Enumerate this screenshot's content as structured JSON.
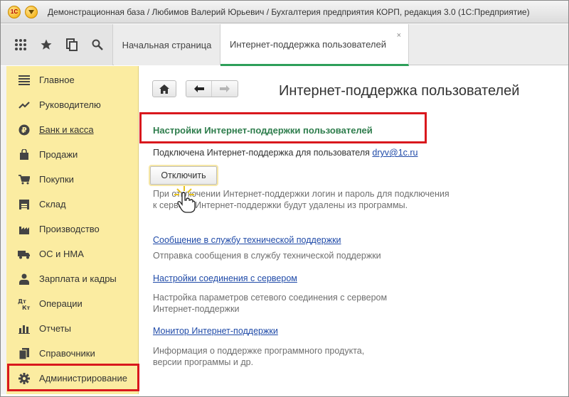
{
  "window": {
    "title": "Демонстрационная база / Любимов Валерий Юрьевич / Бухгалтерия предприятия КОРП, редакция 3.0  (1С:Предприятие)",
    "logo_text": "1С"
  },
  "toolbar": {
    "icons": [
      "apps-grid-icon",
      "star-icon",
      "history-icon",
      "search-icon"
    ]
  },
  "tabs": [
    {
      "label": "Начальная страница",
      "active": false
    },
    {
      "label": "Интернет-поддержка пользователей",
      "active": true,
      "close": "×"
    }
  ],
  "sidebar": {
    "items": [
      {
        "label": "Главное",
        "icon": "menu-lines-icon"
      },
      {
        "label": "Руководителю",
        "icon": "trend-icon"
      },
      {
        "label": "Банк и касса",
        "icon": "ruble-icon"
      },
      {
        "label": "Продажи",
        "icon": "bag-icon"
      },
      {
        "label": "Покупки",
        "icon": "cart-icon"
      },
      {
        "label": "Склад",
        "icon": "warehouse-icon"
      },
      {
        "label": "Производство",
        "icon": "factory-icon"
      },
      {
        "label": "ОС и НМА",
        "icon": "truck-icon"
      },
      {
        "label": "Зарплата и кадры",
        "icon": "person-icon"
      },
      {
        "label": "Операции",
        "icon": "dt-kt-icon",
        "icon_text": "Дт Кт"
      },
      {
        "label": "Отчеты",
        "icon": "bar-chart-icon"
      },
      {
        "label": "Справочники",
        "icon": "books-icon"
      },
      {
        "label": "Администрирование",
        "icon": "gear-icon"
      }
    ]
  },
  "main": {
    "title": "Интернет-поддержка пользователей",
    "section_title": "Настройки Интернет-поддержки пользователей",
    "connected_text": "Подключена Интернет-поддержка для пользователя",
    "user_link": "dryv@1c.ru",
    "disconnect_button": "Отключить",
    "disconnect_note_line1": "При отключении Интернет-поддержки логин и пароль для подключения",
    "disconnect_note_line2": "к серверу Интернет-поддержки будут удалены из программы.",
    "links": [
      {
        "label": "Сообщение в службу технической поддержки",
        "desc_line1": "Отправка сообщения в службу технической поддержки",
        "desc_line2": ""
      },
      {
        "label": "Настройки соединения с сервером",
        "desc_line1": "Настройка параметров сетевого соединения с сервером",
        "desc_line2": "Интернет-поддержки"
      },
      {
        "label": "Монитор Интернет-поддержки",
        "desc_line1": "Информация о поддержке программного продукта,",
        "desc_line2": "версии программы и др."
      }
    ]
  }
}
